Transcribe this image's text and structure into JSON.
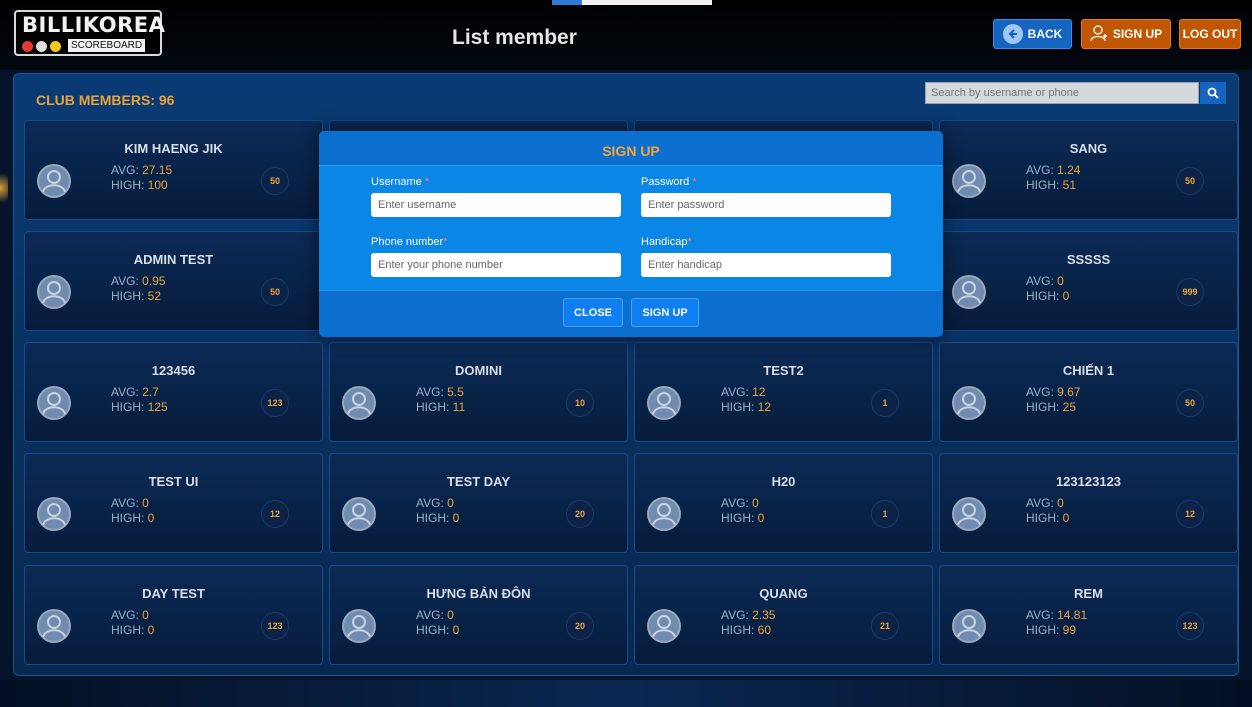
{
  "header": {
    "logo_text": "BILLIKOREA",
    "logo_subtext": "SCOREBOARD",
    "logo_dot_colors": [
      "#e53935",
      "#e0e0e0",
      "#f5c518"
    ],
    "page_title": "List member",
    "back_label": "BACK",
    "signup_label": "SIGN UP",
    "logout_label": "LOG OUT"
  },
  "panel": {
    "club_members_label": "CLUB MEMBERS: 96",
    "search_placeholder": "Search by username or phone"
  },
  "labels": {
    "avg": "AVG: ",
    "high": "HIGH: "
  },
  "members": [
    {
      "name": "KIM HAENG JIK",
      "avg": "27.15",
      "high": "100",
      "handicap": "50"
    },
    {
      "name": "",
      "avg": "",
      "high": "",
      "handicap": ""
    },
    {
      "name": "",
      "avg": "",
      "high": "",
      "handicap": ""
    },
    {
      "name": "SANG",
      "avg": "1.24",
      "high": "51",
      "handicap": "50"
    },
    {
      "name": "ADMIN TEST",
      "avg": "0.95",
      "high": "52",
      "handicap": "50"
    },
    {
      "name": "",
      "avg": "",
      "high": "",
      "handicap": ""
    },
    {
      "name": "",
      "avg": "",
      "high": "",
      "handicap": ""
    },
    {
      "name": "SSSSS",
      "avg": "0",
      "high": "0",
      "handicap": "999"
    },
    {
      "name": "123456",
      "avg": "2.7",
      "high": "125",
      "handicap": "123"
    },
    {
      "name": "DOMINI",
      "avg": "5.5",
      "high": "11",
      "handicap": "10"
    },
    {
      "name": "TEST2",
      "avg": "12",
      "high": "12",
      "handicap": "1"
    },
    {
      "name": "CHIẾN 1",
      "avg": "9.67",
      "high": "25",
      "handicap": "50"
    },
    {
      "name": "TEST UI",
      "avg": "0",
      "high": "0",
      "handicap": "12"
    },
    {
      "name": "TEST DAY",
      "avg": "0",
      "high": "0",
      "handicap": "20"
    },
    {
      "name": "H20",
      "avg": "0",
      "high": "0",
      "handicap": "1"
    },
    {
      "name": "123123123",
      "avg": "0",
      "high": "0",
      "handicap": "12"
    },
    {
      "name": "DAY TEST",
      "avg": "0",
      "high": "0",
      "handicap": "123"
    },
    {
      "name": "HƯNG BẢN ĐÔN",
      "avg": "0",
      "high": "0",
      "handicap": "20"
    },
    {
      "name": "QUANG",
      "avg": "2.35",
      "high": "60",
      "handicap": "21"
    },
    {
      "name": "REM",
      "avg": "14.81",
      "high": "99",
      "handicap": "123"
    }
  ],
  "modal": {
    "title": "SIGN UP",
    "username_label": "Username ",
    "username_placeholder": "Enter username",
    "password_label": "Password ",
    "password_placeholder": "Enter password",
    "phone_label": "Phone number",
    "phone_placeholder": "Enter your phone number",
    "handicap_label": "Handicap",
    "handicap_placeholder": "Enter handicap",
    "required_mark": "*",
    "close_label": "CLOSE",
    "signup_label": "SIGN UP"
  },
  "colors": {
    "accent_orange": "#e8a33a",
    "primary_blue": "#1565c0",
    "danger_orange": "#c15600"
  },
  "icons": {
    "back": "back-arrow-icon",
    "signup": "user-add-icon",
    "search": "search-icon",
    "avatar": "user-avatar-icon"
  }
}
